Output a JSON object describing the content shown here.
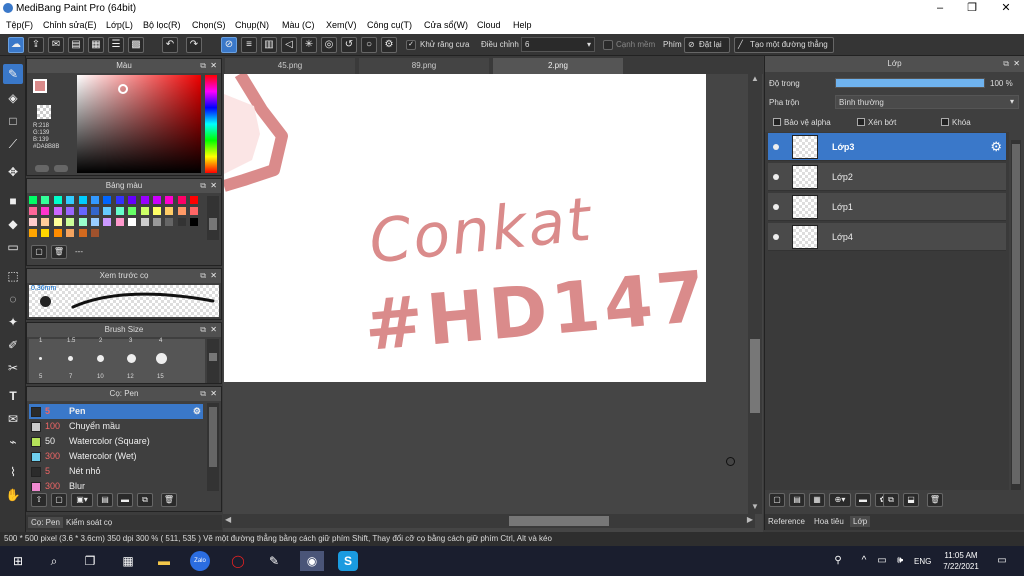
{
  "window": {
    "title": "MediBang Paint Pro (64bit)",
    "minimize": "–",
    "maximize": "❐",
    "close": "✕"
  },
  "menu": [
    "Tệp(F)",
    "Chỉnh sửa(E)",
    "Lớp(L)",
    "Bộ lọc(R)",
    "Chọn(S)",
    "Chụp(N)",
    "Màu (C)",
    "Xem(V)",
    "Công cụ(T)",
    "Cửa sổ(W)",
    "Cloud",
    "Help"
  ],
  "toolbar": {
    "antialias": "Khử răng cưa",
    "adjust_label": "Điều chỉnh",
    "adjust_value": "6",
    "ruler_snap": "Cạnh mềm",
    "phim": "Phím",
    "reset": "Đặt lại",
    "create_line": "Tạo một đường thẳng"
  },
  "color_panel": {
    "title": "Màu",
    "r": "R:218",
    "g": "G:139",
    "b": "B:139",
    "hex": "#DA8B8B",
    "fg": "#DA8B8B"
  },
  "palette_panel": {
    "title": "Bảng màu",
    "name": "---"
  },
  "preview_panel": {
    "title": "Xem trước cọ",
    "size": "0.36mm"
  },
  "brushsize_panel": {
    "title": "Brush Size",
    "row1": [
      "1",
      "1.5",
      "2",
      "3",
      "4"
    ],
    "row2": [
      "5",
      "7",
      "10",
      "12",
      "15"
    ]
  },
  "brush_panel": {
    "title": "Cọ: Pen",
    "items": [
      {
        "size": "5",
        "name": "Pen",
        "color": "#2b2b2b"
      },
      {
        "size": "100",
        "name": "Chuyển mầu",
        "color": "#cccccc"
      },
      {
        "size": "50",
        "name": "Watercolor (Square)",
        "color": "#b6e35a"
      },
      {
        "size": "300",
        "name": "Watercolor (Wet)",
        "color": "#6fcfee"
      },
      {
        "size": "5",
        "name": "Nét nhỏ",
        "color": "#2b2b2b"
      },
      {
        "size": "300",
        "name": "Blur",
        "color": "#f08ad0"
      }
    ]
  },
  "left_bottom_tabs": {
    "brush": "Cọ: Pen",
    "material": "Kiểm soát cọ"
  },
  "tabs": [
    "45.png",
    "89.png",
    "2.png"
  ],
  "canvas": {
    "line1": "Conkat",
    "line2": "#HD147",
    "ink": "#DA8B8B"
  },
  "layer_panel": {
    "title": "Lớp",
    "opacity_label": "Độ trong",
    "opacity_value": "100 %",
    "opacity": 1.0,
    "blend_label": "Pha trộn",
    "blend_value": "Bình thường",
    "protect_alpha": "Bảo vệ alpha",
    "clip": "Xén bớt",
    "lock": "Khóa",
    "layers": [
      "Lớp3",
      "Lớp2",
      "Lớp1",
      "Lớp4"
    ]
  },
  "right_bottom_tabs": {
    "reference": "Reference",
    "texture": "Hoa tiêu",
    "layer": "Lớp"
  },
  "status": {
    "text": "500 * 500 pixel   (3.6 * 3.6cm)   350 dpi   300 %   ( 511, 535 )   Vẽ một đường thẳng bằng cách giữ phím Shift, Thay đổi cỡ cọ bằng cách giữ phím Ctrl, Alt và kéo"
  },
  "taskbar": {
    "lang": "ENG",
    "time": "11:05 AM",
    "date": "7/22/2021"
  }
}
